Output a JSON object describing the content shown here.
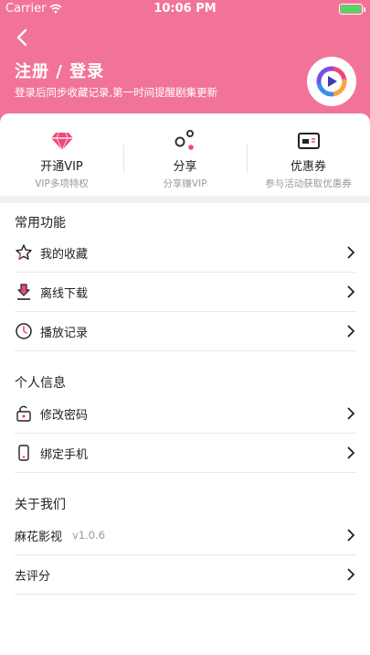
{
  "status_bar": {
    "carrier": "Carrier",
    "time": "10:06 PM"
  },
  "header": {
    "title": "注册 / 登录",
    "subtitle": "登录后同步收藏记录,第一时间提醒剧集更新",
    "icons": {
      "back": "back-arrow-icon",
      "logo": "app-play-logo"
    }
  },
  "quick_actions": [
    {
      "title": "开通VIP",
      "desc": "VIP多项特权",
      "icon": "diamond-icon"
    },
    {
      "title": "分享",
      "desc": "分享赚VIP",
      "icon": "share-icon"
    },
    {
      "title": "优惠券",
      "desc": "参与活动获取优惠券",
      "icon": "coupon-icon"
    }
  ],
  "sections": {
    "common": {
      "title": "常用功能",
      "items": [
        {
          "label": "我的收藏",
          "icon": "star-icon"
        },
        {
          "label": "离线下载",
          "icon": "download-icon"
        },
        {
          "label": "播放记录",
          "icon": "clock-icon"
        }
      ]
    },
    "personal": {
      "title": "个人信息",
      "items": [
        {
          "label": "修改密码",
          "icon": "lock-icon"
        },
        {
          "label": "绑定手机",
          "icon": "phone-icon"
        }
      ]
    },
    "about": {
      "title": "关于我们",
      "items": [
        {
          "label": "麻花影视",
          "version": "v1.0.6"
        },
        {
          "label": "去评分"
        }
      ]
    }
  },
  "colors": {
    "brand_pink": "#f17498",
    "accent_pink": "#f0487a",
    "battery_green": "#4cd964"
  }
}
